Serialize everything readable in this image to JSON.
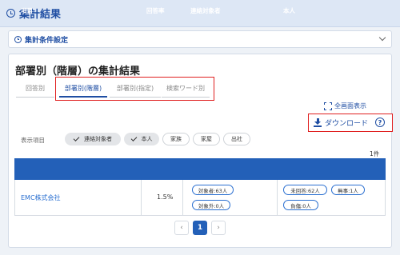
{
  "header": {
    "title": "集計結果",
    "icon": "clock-icon"
  },
  "conditions": {
    "label": "集計条件設定",
    "icon": "clock-icon"
  },
  "results": {
    "title": "部署別（階層）の集計結果",
    "tabs": [
      "回答別",
      "部署別(階層)",
      "部署別(指定)",
      "検索ワード別"
    ],
    "active_tab": 1,
    "full_screen_label": "全画面表示",
    "download_label": "ダウンロード",
    "help_label": "?",
    "display_items_label": "表示項目",
    "display_items": [
      {
        "label": "連絡対象者",
        "checked": true
      },
      {
        "label": "本人",
        "checked": true
      },
      {
        "label": "家族",
        "checked": false
      },
      {
        "label": "家屋",
        "checked": false
      },
      {
        "label": "出社",
        "checked": false
      }
    ],
    "count_label": "1件",
    "columns": [
      "項目",
      "回答率",
      "連絡対象者",
      "本人"
    ],
    "rows": [
      {
        "item": "EMC株式会社",
        "rate": "1.5%",
        "contact": [
          "対象者:63人",
          "対象外:0人"
        ],
        "self": [
          "未回答:62人",
          "無事:1人",
          "負傷:0人"
        ]
      }
    ],
    "pagination": {
      "prev": "‹",
      "current": "1",
      "next": "›"
    }
  },
  "colors": {
    "accent": "#1f4ea3",
    "table_header": "#2360b8",
    "highlight_box": "#e02020"
  }
}
